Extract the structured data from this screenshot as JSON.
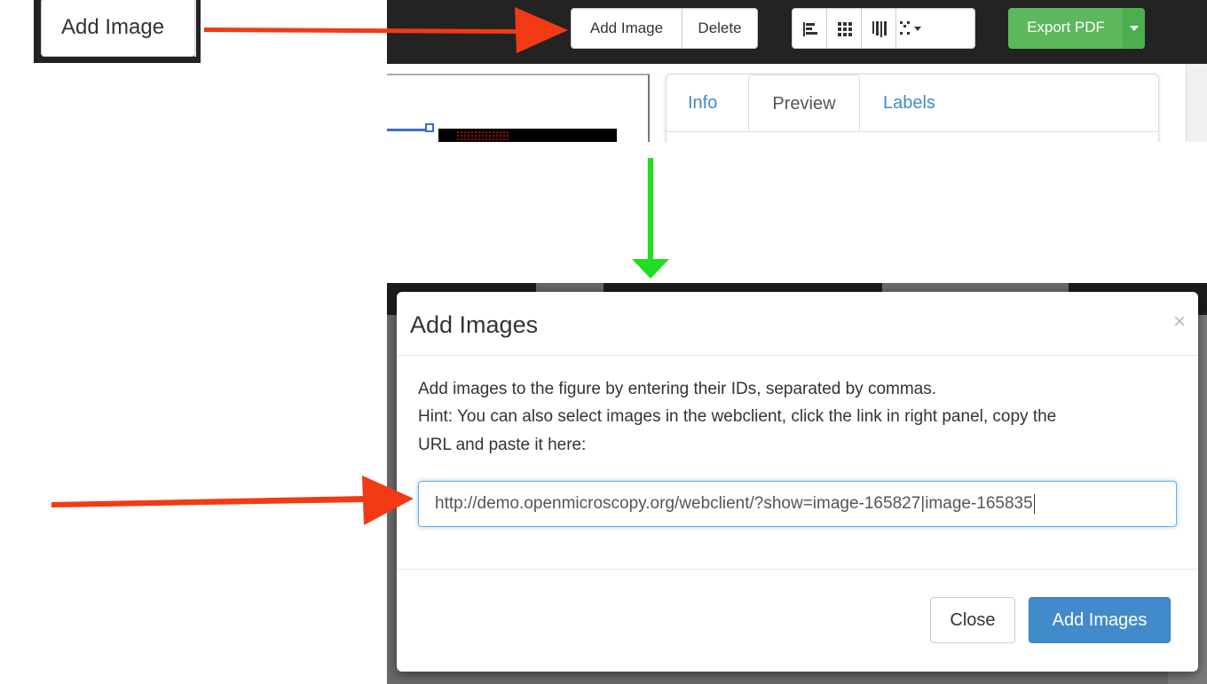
{
  "zoom": {
    "button_label": "Add Image"
  },
  "toolbar": {
    "add_image_label": "Add Image",
    "delete_label": "Delete",
    "export_label": "Export PDF",
    "icons": [
      "align-left-icon",
      "grid-icon",
      "columns-icon",
      "expand-icon"
    ]
  },
  "right_panel": {
    "tabs": [
      {
        "label": "Info",
        "active": false
      },
      {
        "label": "Preview",
        "active": true
      },
      {
        "label": "Labels",
        "active": false
      }
    ]
  },
  "modal": {
    "title": "Add Images",
    "close_symbol": "×",
    "body_lines": [
      "Add images to the figure by entering their IDs, separated by commas.",
      "Hint: You can also select images in the webclient, click the link in right panel, copy the",
      "URL and paste it here:"
    ],
    "input_value": "http://demo.openmicroscopy.org/webclient/?show=image-165827|image-165835",
    "close_button": "Close",
    "add_button": "Add Images"
  },
  "colors": {
    "arrow_red": "#f23a14",
    "arrow_green": "#22dd22",
    "export_green": "#5cb85c",
    "primary_blue": "#428bca",
    "link_blue": "#428bca"
  }
}
